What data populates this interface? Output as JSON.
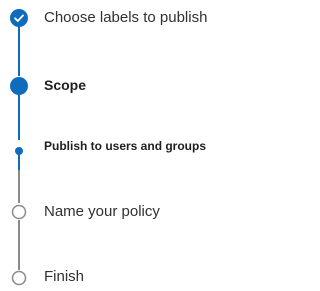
{
  "wizard": {
    "steps": [
      {
        "label": "Choose labels to publish",
        "state": "completed",
        "icon": "check-circle-icon"
      },
      {
        "label": "Scope",
        "state": "current",
        "icon": "filled-circle-icon"
      },
      {
        "label": "Publish to users and groups",
        "state": "current-substep",
        "icon": "small-dot-icon"
      },
      {
        "label": "Name your policy",
        "state": "pending",
        "icon": "empty-circle-icon"
      },
      {
        "label": "Finish",
        "state": "pending",
        "icon": "empty-circle-icon"
      }
    ]
  },
  "colors": {
    "accent": "#0f6cbd",
    "pending": "#8a8a8a",
    "text": "#323130"
  }
}
